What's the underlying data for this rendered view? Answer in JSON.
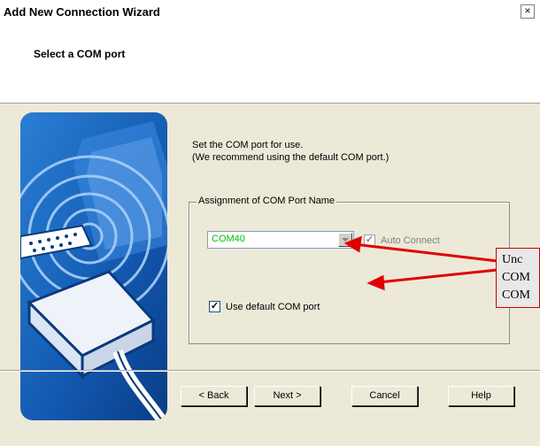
{
  "window": {
    "title": "Add New Connection Wizard",
    "close_glyph": "×"
  },
  "header": {
    "subtitle": "Select a COM port"
  },
  "main": {
    "instruction_line1": "Set the COM port for use.",
    "instruction_line2": "(We recommend using the default COM port.)",
    "group": {
      "legend": "Assignment of COM Port Name",
      "com_port_value": "COM40",
      "auto_connect_label": "Auto Connect",
      "auto_connect_checked": true,
      "auto_connect_enabled": false,
      "use_default_label": "Use default COM port",
      "use_default_checked": true
    }
  },
  "buttons": {
    "back": "< Back",
    "next": "Next >",
    "cancel": "Cancel",
    "help": "Help"
  },
  "annotation": {
    "line1": "Unc",
    "line2": "COM",
    "line3": "COM",
    "arrow_color": "#e00000"
  },
  "colors": {
    "dialog_bg": "#ece9d8",
    "header_bg": "#ffffff",
    "com_value_color": "#00c000",
    "hero_blue": "#1a5fb4"
  }
}
